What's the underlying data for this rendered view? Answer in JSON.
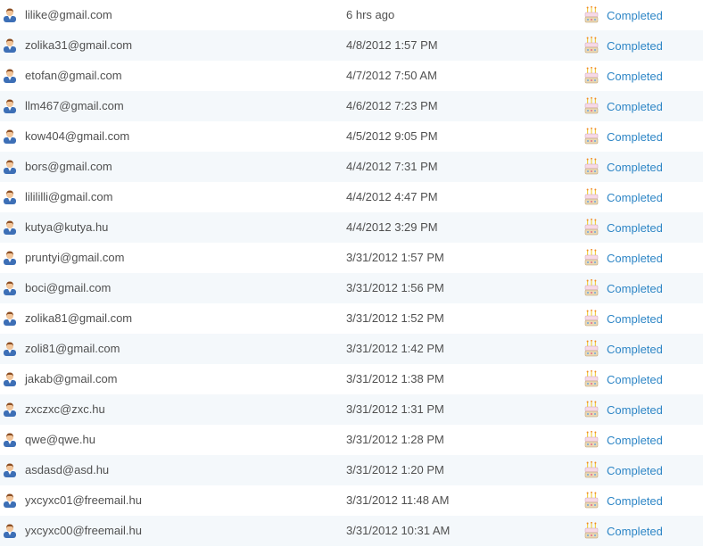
{
  "rows": [
    {
      "email": "lilike@gmail.com",
      "time": "6 hrs ago",
      "status": "Completed"
    },
    {
      "email": "zolika31@gmail.com",
      "time": "4/8/2012 1:57 PM",
      "status": "Completed"
    },
    {
      "email": "etofan@gmail.com",
      "time": "4/7/2012 7:50 AM",
      "status": "Completed"
    },
    {
      "email": "llm467@gmail.com",
      "time": "4/6/2012 7:23 PM",
      "status": "Completed"
    },
    {
      "email": "kow404@gmail.com",
      "time": "4/5/2012 9:05 PM",
      "status": "Completed"
    },
    {
      "email": "bors@gmail.com",
      "time": "4/4/2012 7:31 PM",
      "status": "Completed"
    },
    {
      "email": "lilililli@gmail.com",
      "time": "4/4/2012 4:47 PM",
      "status": "Completed"
    },
    {
      "email": "kutya@kutya.hu",
      "time": "4/4/2012 3:29 PM",
      "status": "Completed"
    },
    {
      "email": "pruntyi@gmail.com",
      "time": "3/31/2012 1:57 PM",
      "status": "Completed"
    },
    {
      "email": "boci@gmail.com",
      "time": "3/31/2012 1:56 PM",
      "status": "Completed"
    },
    {
      "email": "zolika81@gmail.com",
      "time": "3/31/2012 1:52 PM",
      "status": "Completed"
    },
    {
      "email": "zoli81@gmail.com",
      "time": "3/31/2012 1:42 PM",
      "status": "Completed"
    },
    {
      "email": "jakab@gmail.com",
      "time": "3/31/2012 1:38 PM",
      "status": "Completed"
    },
    {
      "email": "zxczxc@zxc.hu",
      "time": "3/31/2012 1:31 PM",
      "status": "Completed"
    },
    {
      "email": "qwe@qwe.hu",
      "time": "3/31/2012 1:28 PM",
      "status": "Completed"
    },
    {
      "email": "asdasd@asd.hu",
      "time": "3/31/2012 1:20 PM",
      "status": "Completed"
    },
    {
      "email": "yxcyxc01@freemail.hu",
      "time": "3/31/2012 11:48 AM",
      "status": "Completed"
    },
    {
      "email": "yxcyxc00@freemail.hu",
      "time": "3/31/2012 10:31 AM",
      "status": "Completed"
    }
  ],
  "icons": {
    "user": "user-icon",
    "status": "birthday-cake-icon"
  },
  "colors": {
    "status_link": "#2e86c6",
    "row_alt_background": "#f4f8fb"
  }
}
